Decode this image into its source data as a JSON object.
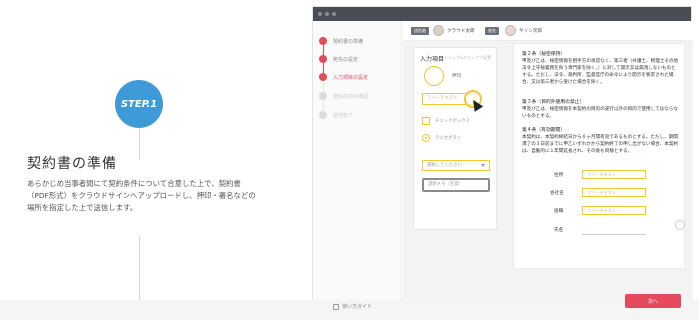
{
  "left": {
    "step_badge": "STEP.1",
    "title": "契約書の準備",
    "description": "あらかじめ当事者間にて契約条件について合意した上で、契約書（PDF形式）をクラウドサインへアップロードし、押印・署名などの場所を指定した上で送信します。"
  },
  "app": {
    "sidebar": {
      "steps": [
        {
          "label": "契約書の準備",
          "state": "done"
        },
        {
          "label": "宛先の設定",
          "state": "done"
        },
        {
          "label": "入力項目の設定",
          "state": "active"
        },
        {
          "label": "送信の前の確認",
          "state": "inactive"
        },
        {
          "label": "送信完了",
          "state": "inactive"
        }
      ],
      "guide": "使い方ガイド"
    },
    "topbar": {
      "sender_role": "送信者",
      "sender_name": "クラウド太郎",
      "receiver_role": "宛先",
      "receiver_name": "サイン次郎"
    },
    "panel": {
      "title": "入力項目",
      "subtitle": "ドラッグ&ドロップで配置",
      "stamp_label": "押印",
      "text_field": "フリーテキスト",
      "checkbox_label": "チェックボックス",
      "radio_label": "ラジオボタン",
      "select_placeholder": "選択してください",
      "memo_placeholder": "説明メモ（任意）"
    },
    "document": {
      "article2_heading": "第２条（秘密保持）",
      "article2_body": "甲及び乙は、秘密情報を相手方の承諾なく、第三者（弁護士、税理士その他法令上守秘義務を負う専門家を除く。）に対して開示又は漏洩しないものとする。ただし、法令、裁判所、監督官庁の命令により開示を要求された場合、又は第三者から受けた場合を除く。",
      "article3_heading": "第３条（目的外使用の禁止）",
      "article3_body": "甲及び乙は、秘密情報を本契約の目的の遂行以外の目的で使用してはならないものとする。",
      "article4_heading": "第４条（有効期間）",
      "article4_body": "本契約は、本契約締結日から６ヶ月間有効であるものとする。ただし、期間満了の３日前までに甲乙いずれかから契約終了の申し出がない場合、本契約は、自動的に１年間延長され、その後も同様とする。",
      "signature_fields": [
        {
          "label": "住所",
          "placeholder": "フリーテキスト"
        },
        {
          "label": "会社名",
          "placeholder": "フリーテキスト"
        },
        {
          "label": "役職",
          "placeholder": "フリーテキスト"
        },
        {
          "label": "氏名",
          "placeholder": ""
        }
      ]
    },
    "next_button": "次へ"
  },
  "colors": {
    "accent_blue": "#3f9ad8",
    "accent_red": "#e44a5c",
    "field_yellow": "#f0c830"
  }
}
